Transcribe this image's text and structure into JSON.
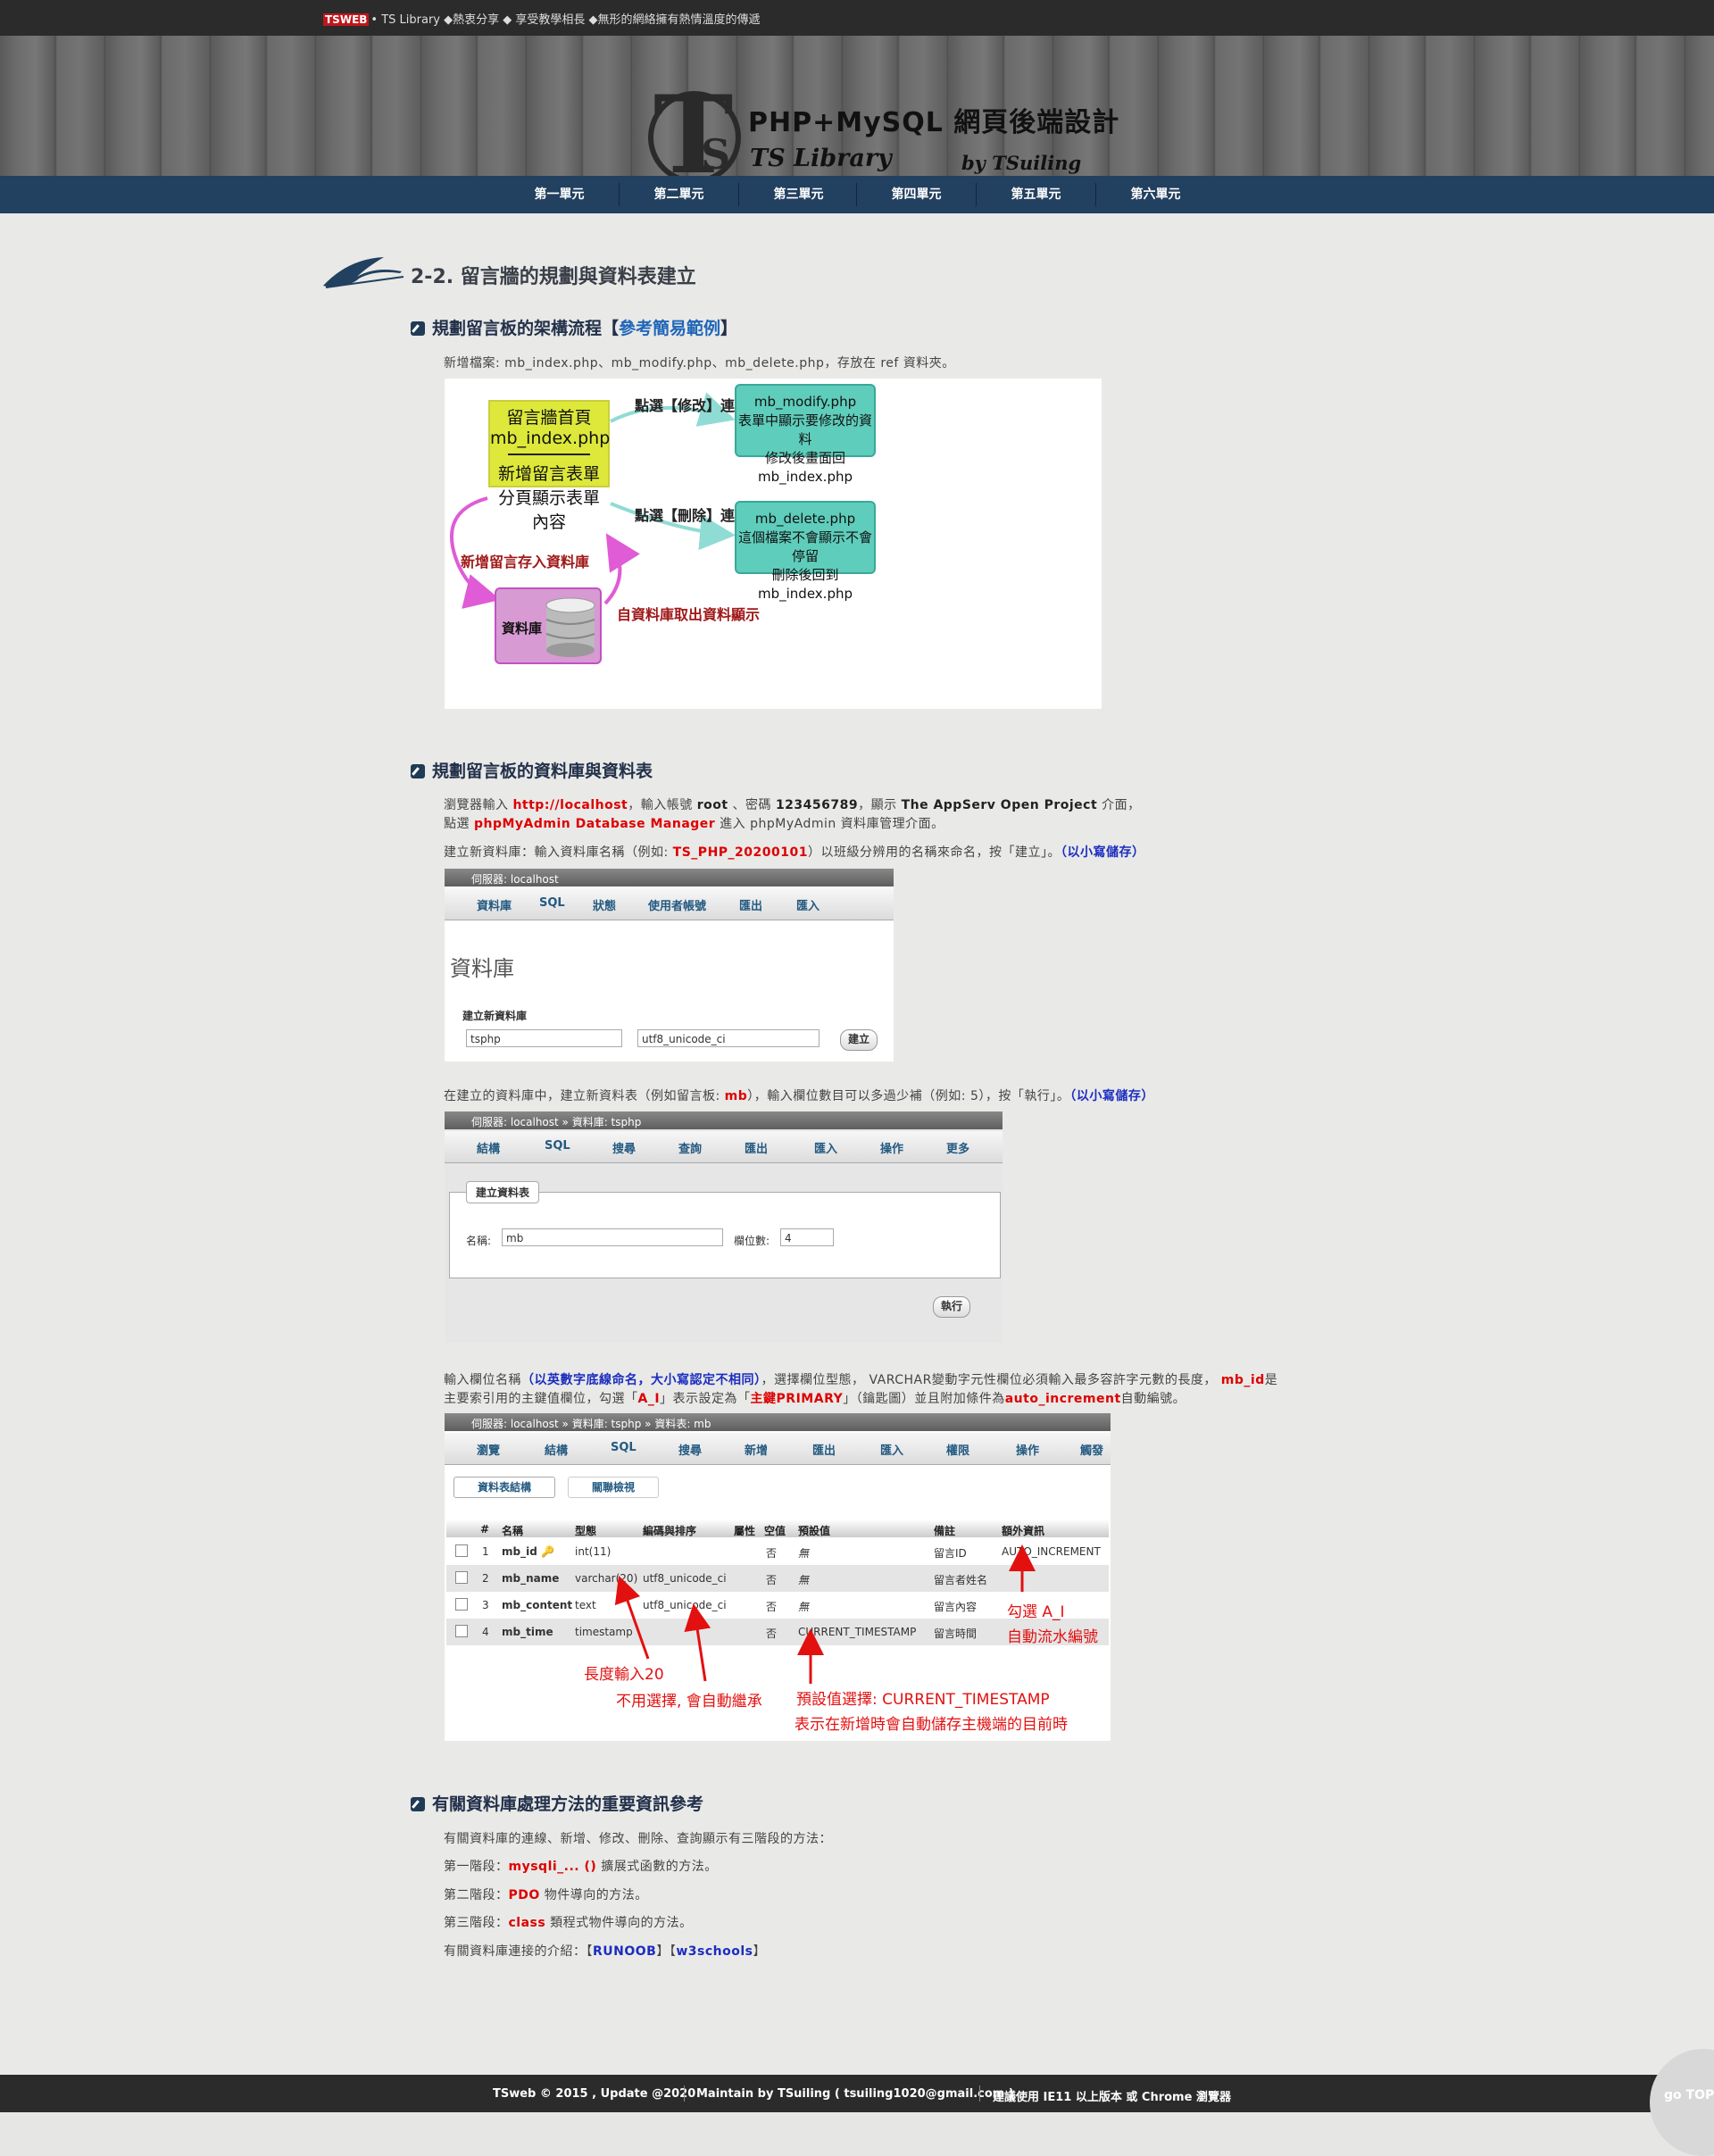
{
  "topbar": {
    "logo": "TS",
    "logo_web": "WEB",
    "tagline": "• TS Library ◆熱衷分享 ◆ 享受教學相長 ◆無形的網絡擁有熱情溫度的傳遞"
  },
  "header": {
    "title": "PHP+MySQL 網頁後端設計",
    "subtitle": "TS Library",
    "by": "by TSuiling",
    "logo_T": "T",
    "logo_S": "S"
  },
  "nav": [
    "第一單元",
    "第二單元",
    "第三單元",
    "第四單元",
    "第五單元",
    "第六單元"
  ],
  "section": {
    "title": "2-2. 留言牆的規劃與資料表建立"
  },
  "s1": {
    "heading": "規劃留言板的架構流程【",
    "heading_link": "參考簡易範例",
    "heading_end": "】",
    "desc": "新增檔案: mb_index.php、mb_modify.php、mb_delete.php，存放在 ref 資料夾。",
    "flow": {
      "index_line1": "留言牆首頁",
      "index_line2": "mb_index.php",
      "index_line3": "新增留言表單",
      "index_line4": "分頁顯示表單內容",
      "modify_label": "點選【修改】連結",
      "modify_l1": "mb_modify.php",
      "modify_l2": "表單中顯示要修改的資料",
      "modify_l3": "修改後畫面回mb_index.php",
      "delete_label": "點選【刪除】連結",
      "delete_l1": "mb_delete.php",
      "delete_l2": "這個檔案不會顯示不會停留",
      "delete_l3": "刪除後回到mb_index.php",
      "save_label": "新增留言存入資料庫",
      "fetch_label": "自資料庫取出資料顯示",
      "db_label": "資料庫"
    }
  },
  "s2": {
    "heading": "規劃留言板的資料庫與資料表",
    "p1_a": "瀏覽器輸入 ",
    "p1_url": "http://localhost",
    "p1_b": "，輸入帳號 ",
    "p1_user": "root",
    "p1_c": " 、密碼 ",
    "p1_pw": "123456789",
    "p1_d": "，顯示 ",
    "p1_app": "The AppServ Open Project",
    "p1_e": " 介面，",
    "p2_a": "點選 ",
    "p2_pma": "phpMyAdmin Database Manager",
    "p2_b": " 進入 phpMyAdmin 資料庫管理介面。",
    "p3_a": "建立新資料庫：輸入資料庫名稱（例如: ",
    "p3_name": "TS_PHP_20200101",
    "p3_b": "）以班級分辨用的名稱來命名，按「建立」。",
    "p3_c": "（以小寫儲存）",
    "shot1": {
      "bar": "伺服器: localhost",
      "tabs": [
        "資料庫",
        "SQL",
        "狀態",
        "使用者帳號",
        "匯出",
        "匯入"
      ],
      "title": "資料庫",
      "create_label": "建立新資料庫",
      "db_value": "tsphp",
      "collation": "utf8_unicode_ci",
      "btn": "建立"
    },
    "p4_a": "在建立的資料庫中，建立新資料表（例如留言板: ",
    "p4_mb": "mb",
    "p4_b": "），輸入欄位數目可以多過少補（例如: 5），按「執行」。",
    "p4_c": "（以小寫儲存）",
    "shot2": {
      "bar": "伺服器: localhost » 資料庫: tsphp",
      "tabs": [
        "結構",
        "SQL",
        "搜尋",
        "查詢",
        "匯出",
        "匯入",
        "操作",
        "更多"
      ],
      "legend": "建立資料表",
      "name_label": "名稱:",
      "name_value": "mb",
      "cols_label": "欄位數:",
      "cols_value": "4",
      "btn": "執行"
    },
    "p5_a": "輸入欄位名稱",
    "p5_b": "（以英數字底線命名，大小寫認定不相同）",
    "p5_c": "，選擇欄位型態， VARCHAR變動字元性欄位必須輸入最多容許字元數的長度， ",
    "p5_id": "mb_id",
    "p5_d": "是",
    "p6_a": "主要索引用的主鍵值欄位，勾選「",
    "p6_ai": "A_I",
    "p6_b": "」表示設定為「",
    "p6_pk": "主鍵PRIMARY",
    "p6_c": "」（鑰匙圖）並且附加條件為",
    "p6_auto": "auto_increment",
    "p6_d": "自動編號。",
    "shot3": {
      "bar": "伺服器: localhost » 資料庫: tsphp » 資料表: mb",
      "tabs": [
        "瀏覽",
        "結構",
        "SQL",
        "搜尋",
        "新增",
        "匯出",
        "匯入",
        "權限",
        "操作",
        "觸發"
      ],
      "subtabs": [
        "資料表結構",
        "關聯檢視"
      ],
      "headers": [
        "#",
        "名稱",
        "型態",
        "編碼與排序",
        "屬性",
        "空值",
        "預設值",
        "備註",
        "額外資訊"
      ],
      "rows": [
        {
          "n": "1",
          "name": "mb_id",
          "type": "int(11)",
          "coll": "",
          "null": "否",
          "def": "無",
          "comment": "留言ID",
          "extra": "AUTO_INCREMENT"
        },
        {
          "n": "2",
          "name": "mb_name",
          "type": "varchar(20)",
          "coll": "utf8_unicode_ci",
          "null": "否",
          "def": "無",
          "comment": "留言者姓名",
          "extra": ""
        },
        {
          "n": "3",
          "name": "mb_content",
          "type": "text",
          "coll": "utf8_unicode_ci",
          "null": "否",
          "def": "無",
          "comment": "留言內容",
          "extra": ""
        },
        {
          "n": "4",
          "name": "mb_time",
          "type": "timestamp",
          "coll": "",
          "null": "否",
          "def": "CURRENT_TIMESTAMP",
          "comment": "留言時間",
          "extra": ""
        }
      ],
      "ann_len": "長度輸入20",
      "ann_coll": "不用選擇, 會自動繼承",
      "ann_def1": "預設值選擇: CURRENT_TIMESTAMP",
      "ann_def2": "表示在新增時會自動儲存主機端的目前時",
      "ann_ai1": "勾選 A_I",
      "ann_ai2": "自動流水編號"
    }
  },
  "s3": {
    "heading": "有關資料庫處理方法的重要資訊參考",
    "l1": "有關資料庫的連線、新增、修改、刪除、查詢顯示有三階段的方法：",
    "l2_a": "第一階段：",
    "l2_b": "mysqli_... ()",
    "l2_c": " 擴展式函數的方法。",
    "l3_a": "第二階段：",
    "l3_b": "PDO",
    "l3_c": " 物件導向的方法。",
    "l4_a": "第三階段：",
    "l4_b": "class",
    "l4_c": " 類程式物件導向的方法。",
    "l5_a": "有關資料庫連接的介紹：【",
    "l5_b": "RUNOOB",
    "l5_c": "】【",
    "l5_d": "w3schools",
    "l5_e": "】"
  },
  "footer": {
    "f1": "TSweb © 2015 , Update @2020",
    "f2": "Maintain by TSuiling ( tsuiling1020@gmail.com )",
    "f3": "建議使用 IE11 以上版本 或 Chrome 瀏覽器",
    "gotop": "go TOP"
  },
  "colors": {
    "nav": "#22405f",
    "topbar": "#2b2b2b",
    "accent_red": "#d00000",
    "accent_blue": "#1b2dbf",
    "flow_yellow": "#dde83a",
    "flow_teal": "#5fcdbb",
    "flow_pink": "#d79ad3"
  }
}
